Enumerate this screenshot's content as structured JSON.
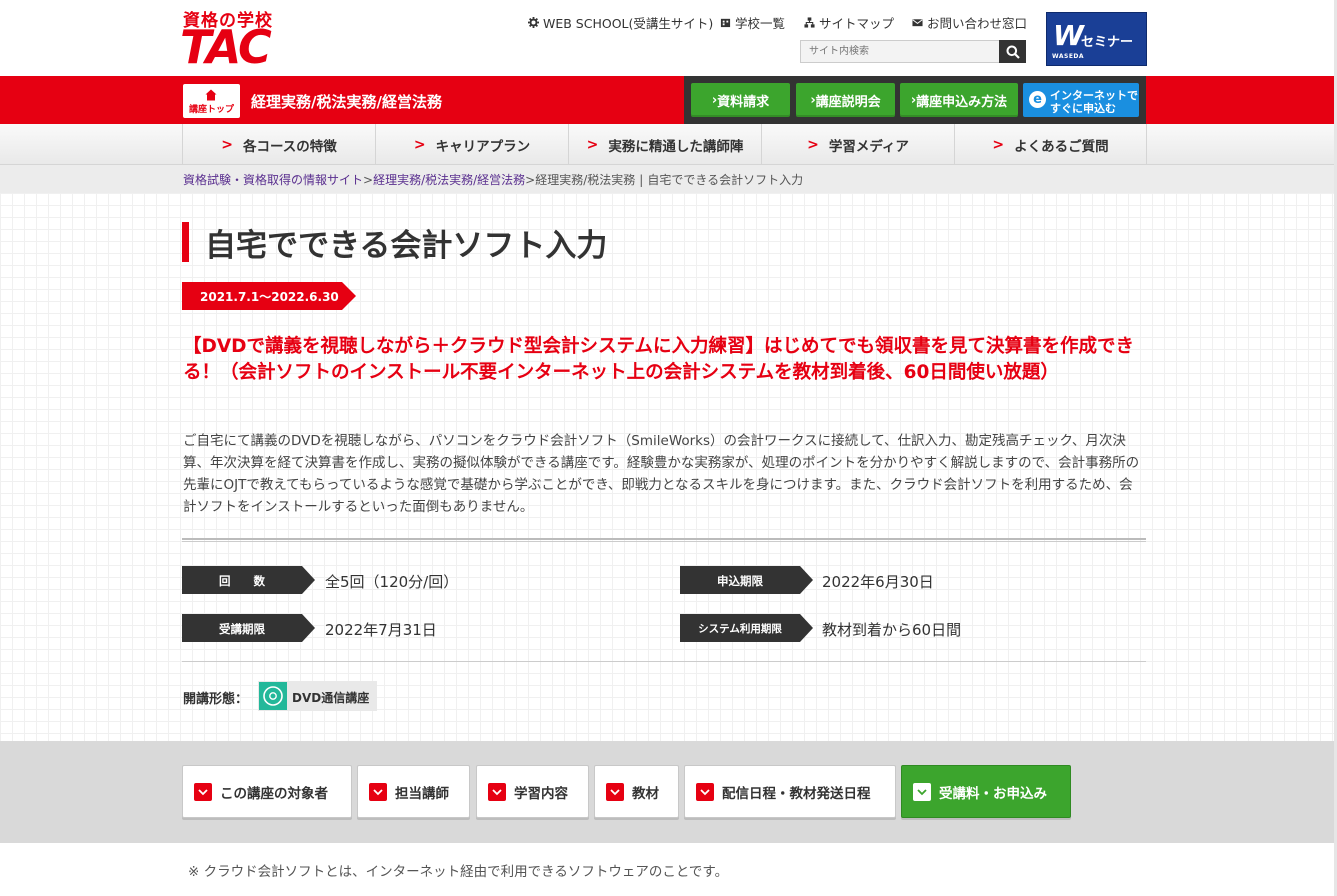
{
  "header": {
    "logo_top": "資格の学校",
    "logo_main": "TAC",
    "utility_links": [
      {
        "label": "WEB SCHOOL(受講生サイト)",
        "icon": "gear-icon"
      },
      {
        "label": "学校一覧",
        "icon": "building-icon"
      },
      {
        "label": "サイトマップ",
        "icon": "sitemap-icon"
      },
      {
        "label": "お問い合わせ窓口",
        "icon": "mail-icon"
      }
    ],
    "search_placeholder": "サイト内検索",
    "partner_logo": {
      "mark": "W",
      "text": "セミナー",
      "sub": "WASEDA"
    }
  },
  "redbar": {
    "course_top_label": "講座トップ",
    "course_name": "経理実務/税法実務/経営法務",
    "buttons": [
      {
        "label": "資料請求"
      },
      {
        "label": "講座説明会"
      },
      {
        "label": "講座申込み方法"
      }
    ],
    "internet_button": {
      "line1": "インターネットで",
      "line2": "すぐに申込む"
    }
  },
  "nav": {
    "items": [
      {
        "label": "各コースの特徴"
      },
      {
        "label": "キャリアプラン"
      },
      {
        "label": "実務に精通した講師陣"
      },
      {
        "label": "学習メディア"
      },
      {
        "label": "よくあるご質問"
      }
    ]
  },
  "breadcrumb": {
    "link1": "資格試験・資格取得の情報サイト",
    "sep1": ">",
    "link2": "経理実務/税法実務/経営法務",
    "sep2": ">",
    "plain": "経理実務/税法実務",
    "divider": "|",
    "current": "自宅でできる会計ソフト入力"
  },
  "main": {
    "title": "自宅でできる会計ソフト入力",
    "period": "2021.7.1～2022.6.30",
    "headline": "【DVDで講義を視聴しながら＋クラウド型会計システムに入力練習】はじめてでも領収書を見て決算書を作成できる！（会計ソフトのインストール不要インターネット上の会計システムを教材到着後、60日間使い放題）",
    "description": "ご自宅にて講義のDVDを視聴しながら、パソコンをクラウド会計ソフト（SmileWorks）の会計ワークスに接続して、仕訳入力、勘定残高チェック、月次決算、年次決算を経て決算書を作成し、実務の擬似体験ができる講座です。経験豊かな実務家が、処理のポイントを分かりやすく解説しますので、会計事務所の先輩にOJTで教えてもらっているような感覚で基礎から学ぶことができ、即戦力となるスキルを身につけます。また、クラウド会計ソフトを利用するため、会計ソフトをインストールするといった面倒もありません。",
    "info": [
      {
        "label": "回　　数",
        "value": "全5回（120分/回）"
      },
      {
        "label": "申込期限",
        "value": "2022年6月30日"
      },
      {
        "label": "受講期限",
        "value": "2022年7月31日"
      },
      {
        "label": "システム利用期限",
        "value": "教材到着から60日間"
      }
    ],
    "format_label": "開講形態：",
    "format_value": "DVD通信講座",
    "format_icon": "disc-icon"
  },
  "tabs": [
    {
      "label": "この講座の対象者"
    },
    {
      "label": "担当講師"
    },
    {
      "label": "学習内容"
    },
    {
      "label": "教材"
    },
    {
      "label": "配信日程・教材発送日程"
    },
    {
      "label": "受講料・お申込み"
    }
  ],
  "footnote": "※ クラウド会計ソフトとは、インターネット経由で利用できるソフトウェアのことです。",
  "colors": {
    "brand_red": "#e60012",
    "action_green": "#3ca52d",
    "internet_blue": "#1a8fe0",
    "partner_navy": "#1a3f96",
    "format_teal": "#23b89a"
  }
}
